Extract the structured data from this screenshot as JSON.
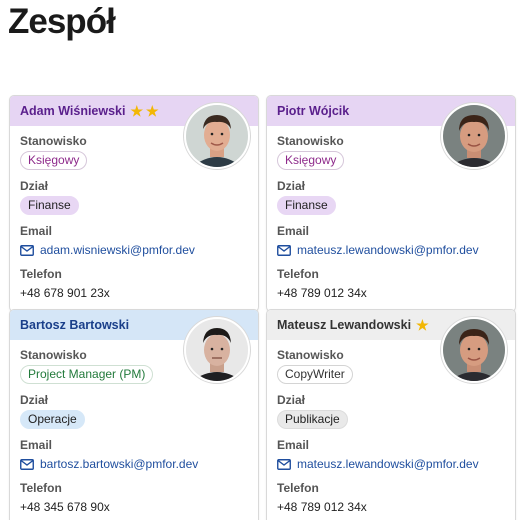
{
  "page": {
    "title": "Zespół"
  },
  "colors": {
    "header_purple": "#e6d5f3",
    "header_blue": "#d5e6f7",
    "header_grey": "#eeeeee",
    "name_purple": "#5a1f8c",
    "name_blue": "#1a3f8a",
    "link_blue": "#1f4e9e",
    "star_gold": "#f2b705"
  },
  "labels": {
    "position": "Stanowisko",
    "department": "Dział",
    "email": "Email",
    "phone": "Telefon"
  },
  "cards": [
    {
      "name": "Adam Wiśniewski",
      "stars": 2,
      "avatar": "avatar-photo",
      "position": "Księgowy",
      "department": "Finanse",
      "email": "adam.wisniewski@pmfor.dev",
      "phone": "+48 678 901 23x"
    },
    {
      "name": "Piotr Wójcik",
      "stars": 0,
      "avatar": "avatar-photo",
      "position": "Księgowy",
      "department": "Finanse",
      "email": "mateusz.lewandowski@pmfor.dev",
      "phone": "+48 789 012 34x"
    },
    {
      "name": "Bartosz Bartowski",
      "stars": 0,
      "avatar": "avatar-photo",
      "position": "Project Manager (PM)",
      "department": "Operacje",
      "email": "bartosz.bartowski@pmfor.dev",
      "phone": "+48 345 678 90x"
    },
    {
      "name": "Mateusz Lewandowski",
      "stars": 1,
      "avatar": "avatar-photo",
      "position": "CopyWriter",
      "department": "Publikacje",
      "email": "mateusz.lewandowski@pmfor.dev",
      "phone": "+48 789 012 34x"
    }
  ]
}
